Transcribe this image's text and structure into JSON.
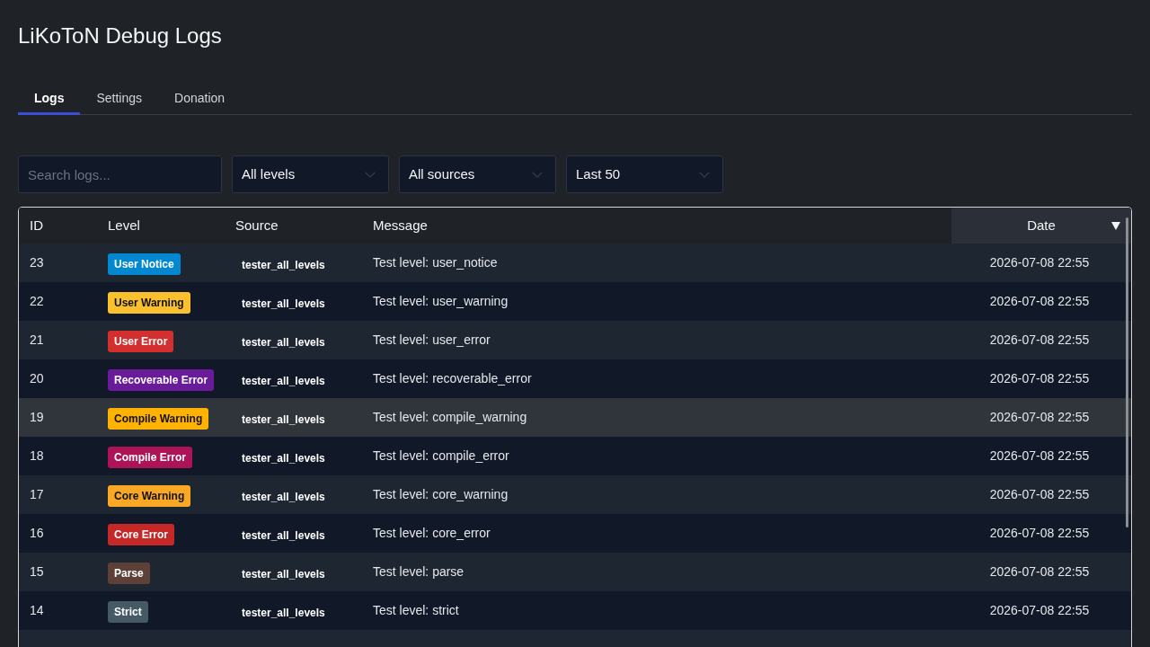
{
  "title": "LiKoToN Debug Logs",
  "tabs": [
    {
      "label": "Logs",
      "selected": true
    },
    {
      "label": "Settings",
      "selected": false
    },
    {
      "label": "Donation",
      "selected": false
    }
  ],
  "filters": {
    "search": {
      "placeholder": "Search logs..."
    },
    "dropdowns": [
      {
        "value": "All levels"
      },
      {
        "value": "All sources"
      },
      {
        "value": "Last 50"
      }
    ]
  },
  "table": {
    "columns": [
      {
        "label": "ID",
        "sorted": false
      },
      {
        "label": "Level",
        "sorted": false
      },
      {
        "label": "Source",
        "sorted": false
      },
      {
        "label": "Message",
        "sorted": false
      },
      {
        "label": "Date",
        "sorted": true
      }
    ],
    "rows": [
      {
        "id": "23",
        "level": {
          "label": "User Notice",
          "color": "#0288d1"
        },
        "source": "tester_all_levels",
        "message": "Test level: user_notice",
        "date": "2026-07-08 22:55",
        "hovered": false
      },
      {
        "id": "22",
        "level": {
          "label": "User Warning",
          "color": "#fbc02d"
        },
        "source": "tester_all_levels",
        "message": "Test level: user_warning",
        "date": "2026-07-08 22:55",
        "hovered": false
      },
      {
        "id": "21",
        "level": {
          "label": "User Error",
          "color": "#d32f2f"
        },
        "source": "tester_all_levels",
        "message": "Test level: user_error",
        "date": "2026-07-08 22:55",
        "hovered": false
      },
      {
        "id": "20",
        "level": {
          "label": "Recoverable Error",
          "color": "#6a1b9a"
        },
        "source": "tester_all_levels",
        "message": "Test level: recoverable_error",
        "date": "2026-07-08 22:55",
        "hovered": false
      },
      {
        "id": "19",
        "level": {
          "label": "Compile Warning",
          "color": "#ffb300"
        },
        "source": "tester_all_levels",
        "message": "Test level: compile_warning",
        "date": "2026-07-08 22:55",
        "hovered": true
      },
      {
        "id": "18",
        "level": {
          "label": "Compile Error",
          "color": "#ad1457"
        },
        "source": "tester_all_levels",
        "message": "Test level: compile_error",
        "date": "2026-07-08 22:55",
        "hovered": false
      },
      {
        "id": "17",
        "level": {
          "label": "Core Warning",
          "color": "#f9a825"
        },
        "source": "tester_all_levels",
        "message": "Test level: core_warning",
        "date": "2026-07-08 22:55",
        "hovered": false
      },
      {
        "id": "16",
        "level": {
          "label": "Core Error",
          "color": "#c62828"
        },
        "source": "tester_all_levels",
        "message": "Test level: core_error",
        "date": "2026-07-08 22:55",
        "hovered": false
      },
      {
        "id": "15",
        "level": {
          "label": "Parse",
          "color": "#5d4037"
        },
        "source": "tester_all_levels",
        "message": "Test level: parse",
        "date": "2026-07-08 22:55",
        "hovered": false
      },
      {
        "id": "14",
        "level": {
          "label": "Strict",
          "color": "#455a64"
        },
        "source": "tester_all_levels",
        "message": "Test level: strict",
        "date": "2026-07-08 22:55",
        "hovered": false
      }
    ]
  }
}
